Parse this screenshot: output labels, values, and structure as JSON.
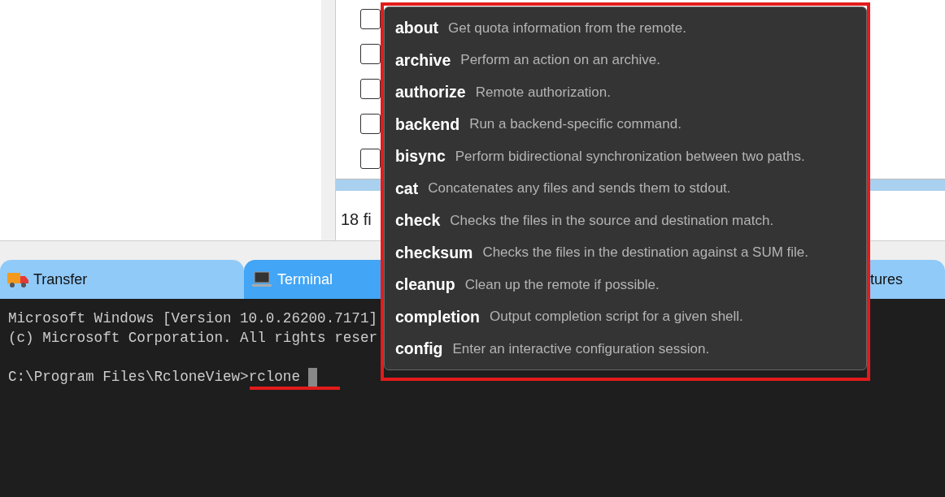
{
  "file_list": {
    "rows": [
      {
        "checked": false
      },
      {
        "checked": false
      },
      {
        "checked": false
      },
      {
        "checked": false
      },
      {
        "checked": false
      }
    ],
    "status": "18 fi"
  },
  "tabs": [
    {
      "label": "Transfer",
      "selected": false
    },
    {
      "label": "Terminal",
      "selected": true
    },
    {
      "label": "tures",
      "selected": false
    }
  ],
  "terminal": {
    "lines": [
      "Microsoft Windows [Version 10.0.26200.7171]",
      "(c) Microsoft Corporation. All rights reser"
    ],
    "prompt": "C:\\Program Files\\RcloneView>",
    "input": "rclone"
  },
  "completion_popup": {
    "items": [
      {
        "command": "about",
        "description": "Get quota information from the remote."
      },
      {
        "command": "archive",
        "description": "Perform an action on an archive."
      },
      {
        "command": "authorize",
        "description": "Remote authorization."
      },
      {
        "command": "backend",
        "description": "Run a backend-specific command."
      },
      {
        "command": "bisync",
        "description": "Perform bidirectional synchronization between two paths."
      },
      {
        "command": "cat",
        "description": "Concatenates any files and sends them to stdout."
      },
      {
        "command": "check",
        "description": "Checks the files in the source and destination match."
      },
      {
        "command": "checksum",
        "description": "Checks the files in the destination against a SUM file."
      },
      {
        "command": "cleanup",
        "description": "Clean up the remote if possible."
      },
      {
        "command": "completion",
        "description": "Output completion script for a given shell."
      },
      {
        "command": "config",
        "description": "Enter an interactive configuration session."
      }
    ]
  }
}
